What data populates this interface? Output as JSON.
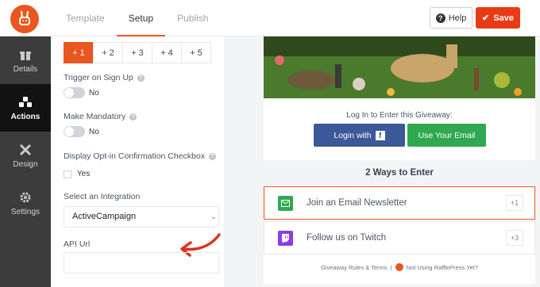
{
  "app": {
    "logo_icon": "rabbit-logo",
    "accent": "#e9561f"
  },
  "tabs": [
    {
      "label": "Template",
      "active": false
    },
    {
      "label": "Setup",
      "active": true
    },
    {
      "label": "Publish",
      "active": false
    }
  ],
  "header": {
    "help_label": "Help",
    "save_label": "Save"
  },
  "sidebar": {
    "items": [
      {
        "label": "Details",
        "icon": "gift-icon",
        "active": false
      },
      {
        "label": "Actions",
        "icon": "actions-icon",
        "active": true
      },
      {
        "label": "Design",
        "icon": "design-icon",
        "active": false
      },
      {
        "label": "Settings",
        "icon": "gear-icon",
        "active": false
      }
    ]
  },
  "settings": {
    "points": [
      "+ 1",
      "+ 2",
      "+ 3",
      "+ 4",
      "+ 5"
    ],
    "selected_points": "+ 1",
    "trigger_label": "Trigger on Sign Up",
    "trigger_value": "No",
    "mandatory_label": "Make Mandatory",
    "mandatory_value": "No",
    "optin_label": "Display Opt-in Confirmation Checkbox",
    "optin_value": "Yes",
    "integration_label": "Select an Integration",
    "integration_value": "ActiveCampaign",
    "api_url_label": "API Url",
    "api_url_value": ""
  },
  "preview": {
    "login_title": "Log In to Enter this Giveaway:",
    "login_fb": "Login with",
    "login_email": "Use Your Email",
    "ways_title": "2 Ways to Enter",
    "entries": [
      {
        "label": "Join an Email Newsletter",
        "points": "+1",
        "icon": "envelope-icon",
        "color": "#2fa84f",
        "selected": true
      },
      {
        "label": "Follow us on Twitch",
        "points": "+3",
        "icon": "twitch-icon",
        "color": "#8a3ee8",
        "selected": false
      }
    ],
    "footer_rules": "Giveaway Rules & Terms",
    "footer_sep": "|",
    "footer_promo": "Not Using RafflePress Yet?"
  }
}
